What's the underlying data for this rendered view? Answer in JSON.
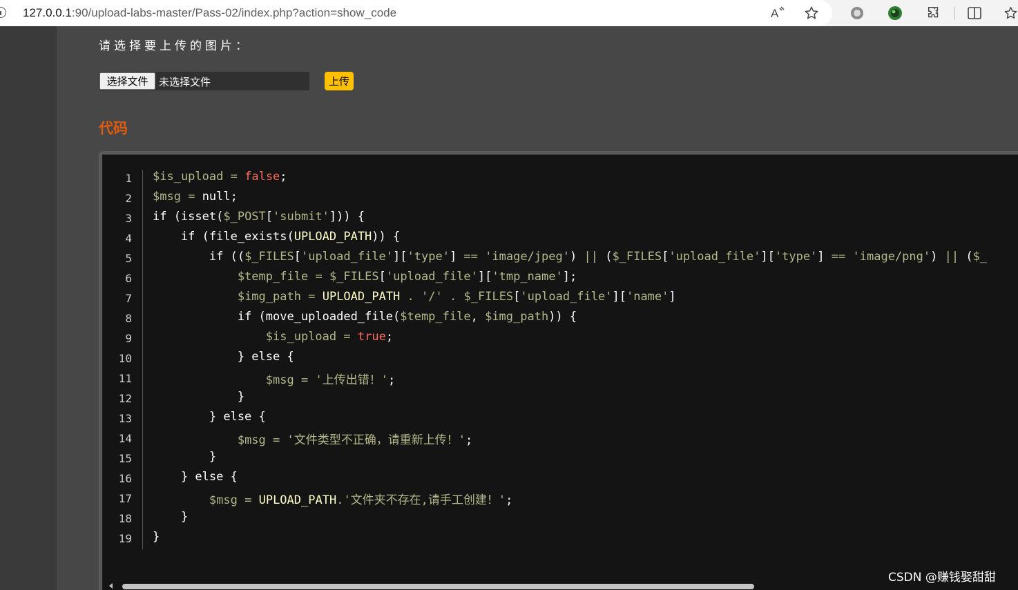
{
  "browser": {
    "url_host": "127.0.0.1",
    "url_rest": ":90/upload-labs-master/Pass-02/index.php?action=show_code"
  },
  "upload": {
    "label": "请选择要上传的图片：",
    "choose_button": "选择文件",
    "file_status": "未选择文件",
    "submit_button": "上传"
  },
  "section_title": "代码",
  "code_lines": [
    {
      "n": "1",
      "t": "$is_upload = false;"
    },
    {
      "n": "2",
      "t": "$msg = null;"
    },
    {
      "n": "3",
      "t": "if (isset($_POST['submit'])) {"
    },
    {
      "n": "4",
      "t": "    if (file_exists(UPLOAD_PATH)) {"
    },
    {
      "n": "5",
      "t": "        if (($_FILES['upload_file']['type'] == 'image/jpeg') || ($_FILES['upload_file']['type'] == 'image/png') || ($_"
    },
    {
      "n": "6",
      "t": "            $temp_file = $_FILES['upload_file']['tmp_name'];"
    },
    {
      "n": "7",
      "t": "            $img_path = UPLOAD_PATH . '/' . $_FILES['upload_file']['name']"
    },
    {
      "n": "8",
      "t": "            if (move_uploaded_file($temp_file, $img_path)) {"
    },
    {
      "n": "9",
      "t": "                $is_upload = true;"
    },
    {
      "n": "10",
      "t": "            } else {"
    },
    {
      "n": "11",
      "t": "                $msg = '上传出错！';"
    },
    {
      "n": "12",
      "t": "            }"
    },
    {
      "n": "13",
      "t": "        } else {"
    },
    {
      "n": "14",
      "t": "            $msg = '文件类型不正确，请重新上传！';"
    },
    {
      "n": "15",
      "t": "        }"
    },
    {
      "n": "16",
      "t": "    } else {"
    },
    {
      "n": "17",
      "t": "        $msg = UPLOAD_PATH.'文件夹不存在,请手工创建！';"
    },
    {
      "n": "18",
      "t": "    }"
    },
    {
      "n": "19",
      "t": "}"
    }
  ],
  "watermark": "CSDN @赚钱娶甜甜",
  "icons": [
    "info-icon",
    "read-aloud-icon",
    "favorite-star-icon",
    "record-icon",
    "extension-green-icon",
    "extensions-puzzle-icon",
    "split-screen-icon",
    "favorites-icon"
  ]
}
